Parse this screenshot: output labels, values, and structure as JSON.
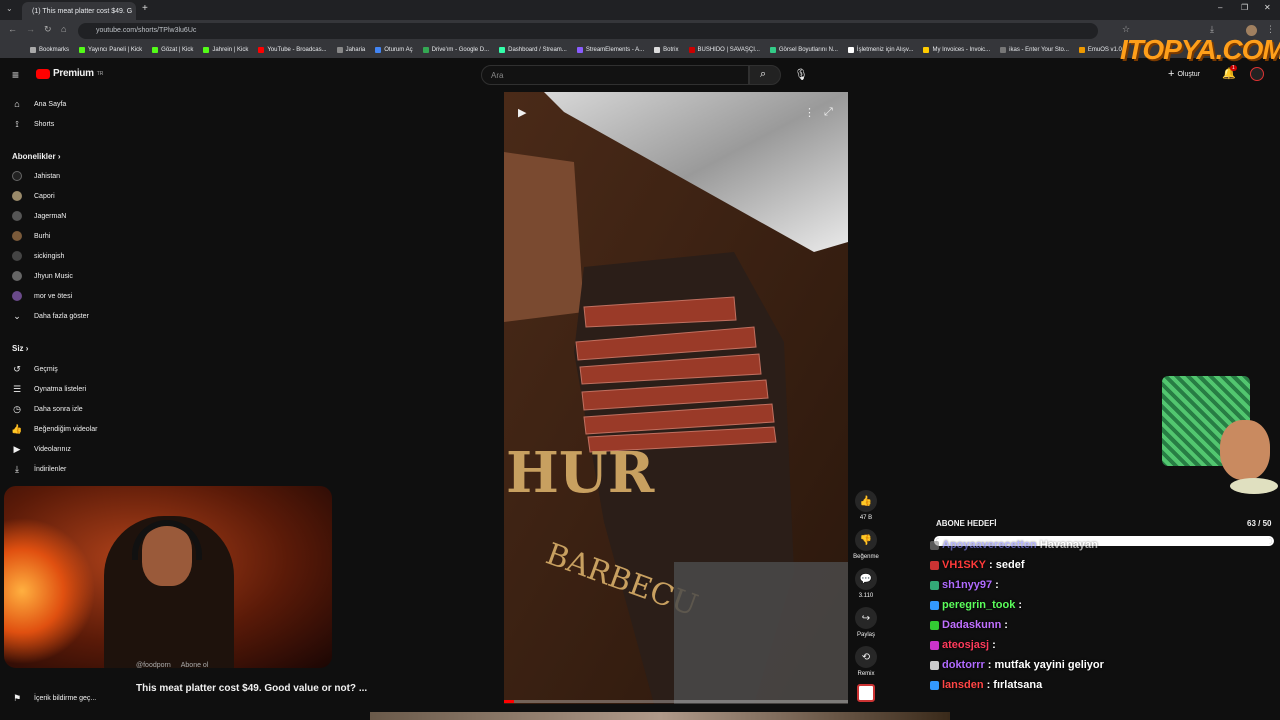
{
  "browser": {
    "tab_title": "(1) This meat platter cost $49. G",
    "url": "youtube.com/shorts/TPlw3lu6Uc",
    "bookmarks": [
      "Bookmarks",
      "Yayıncı Paneli | Kick",
      "Gözat | Kick",
      "Jahrein | Kick",
      "YouTube - Broadcas...",
      "Jaharia",
      "Oturum Aç",
      "Drive'ım - Google D...",
      "Dashboard / Stream...",
      "StreamElements - A...",
      "Botrix",
      "BUSHIDO | SAVAŞÇI...",
      "Görsel Boyutlarını N...",
      "İşletmeniz için Alışv...",
      "My Invoices - Invoic...",
      "ikas - Enter Your Sto...",
      "EmuOS v1.0"
    ]
  },
  "youtube": {
    "logo_text": "Premium",
    "logo_sup": "TR",
    "search_placeholder": "Ara",
    "create_label": "Oluştur",
    "notif_count": "1"
  },
  "sidebar": {
    "home": "Ana Sayfa",
    "shorts": "Shorts",
    "subs_title": "Abonelikler",
    "subs": [
      "Jahistan",
      "Capori",
      "JagermaN",
      "Burhi",
      "sickingish",
      "Jhyun Music",
      "mor ve ötesi"
    ],
    "show_more": "Daha fazla göster",
    "you_title": "Siz",
    "you_items": [
      "Geçmiş",
      "Oynatma listeleri",
      "Daha sonra izle",
      "Beğendiğim videolar",
      "Videolarınız",
      "İndirilenler"
    ],
    "report": "İçerik bildirme geç..."
  },
  "video": {
    "title": "This meat platter cost $49. Good value or not? ...",
    "channel": "@foodporn",
    "subscribe": "Abone ol",
    "sign_text": "HUR",
    "sign_sub": "BARBECU"
  },
  "actions": {
    "likes": "47 B",
    "dislike": "Beğenme",
    "comments": "3.110",
    "share": "Paylaş",
    "remix": "Remix"
  },
  "overlay": {
    "brand": "ITOPYA.COM",
    "goal_label": "ABONE HEDEFİ",
    "goal_count": "63 / 50",
    "goal_fraction": 1.0,
    "chat": [
      {
        "user": "Apoyaaverecetten",
        "msg": "Havanayan",
        "color": "#8a8aff"
      },
      {
        "user": "VH1SKY",
        "msg": ": sedef",
        "color": "#ff3b3b"
      },
      {
        "user": "sh1nyy97",
        "msg": ":",
        "color": "#b06bff"
      },
      {
        "user": "peregrin_took",
        "msg": ":",
        "color": "#5cff5c"
      },
      {
        "user": "Dadaskunn",
        "msg": ":",
        "color": "#c070ff"
      },
      {
        "user": "ateosjasj",
        "msg": ":",
        "color": "#ff3b5c"
      },
      {
        "user": "doktorrr",
        "msg": ": mutfak yayini geliyor",
        "color": "#b06bff"
      },
      {
        "user": "lansden",
        "msg": ": fırlatsana",
        "color": "#ff4646"
      }
    ]
  }
}
